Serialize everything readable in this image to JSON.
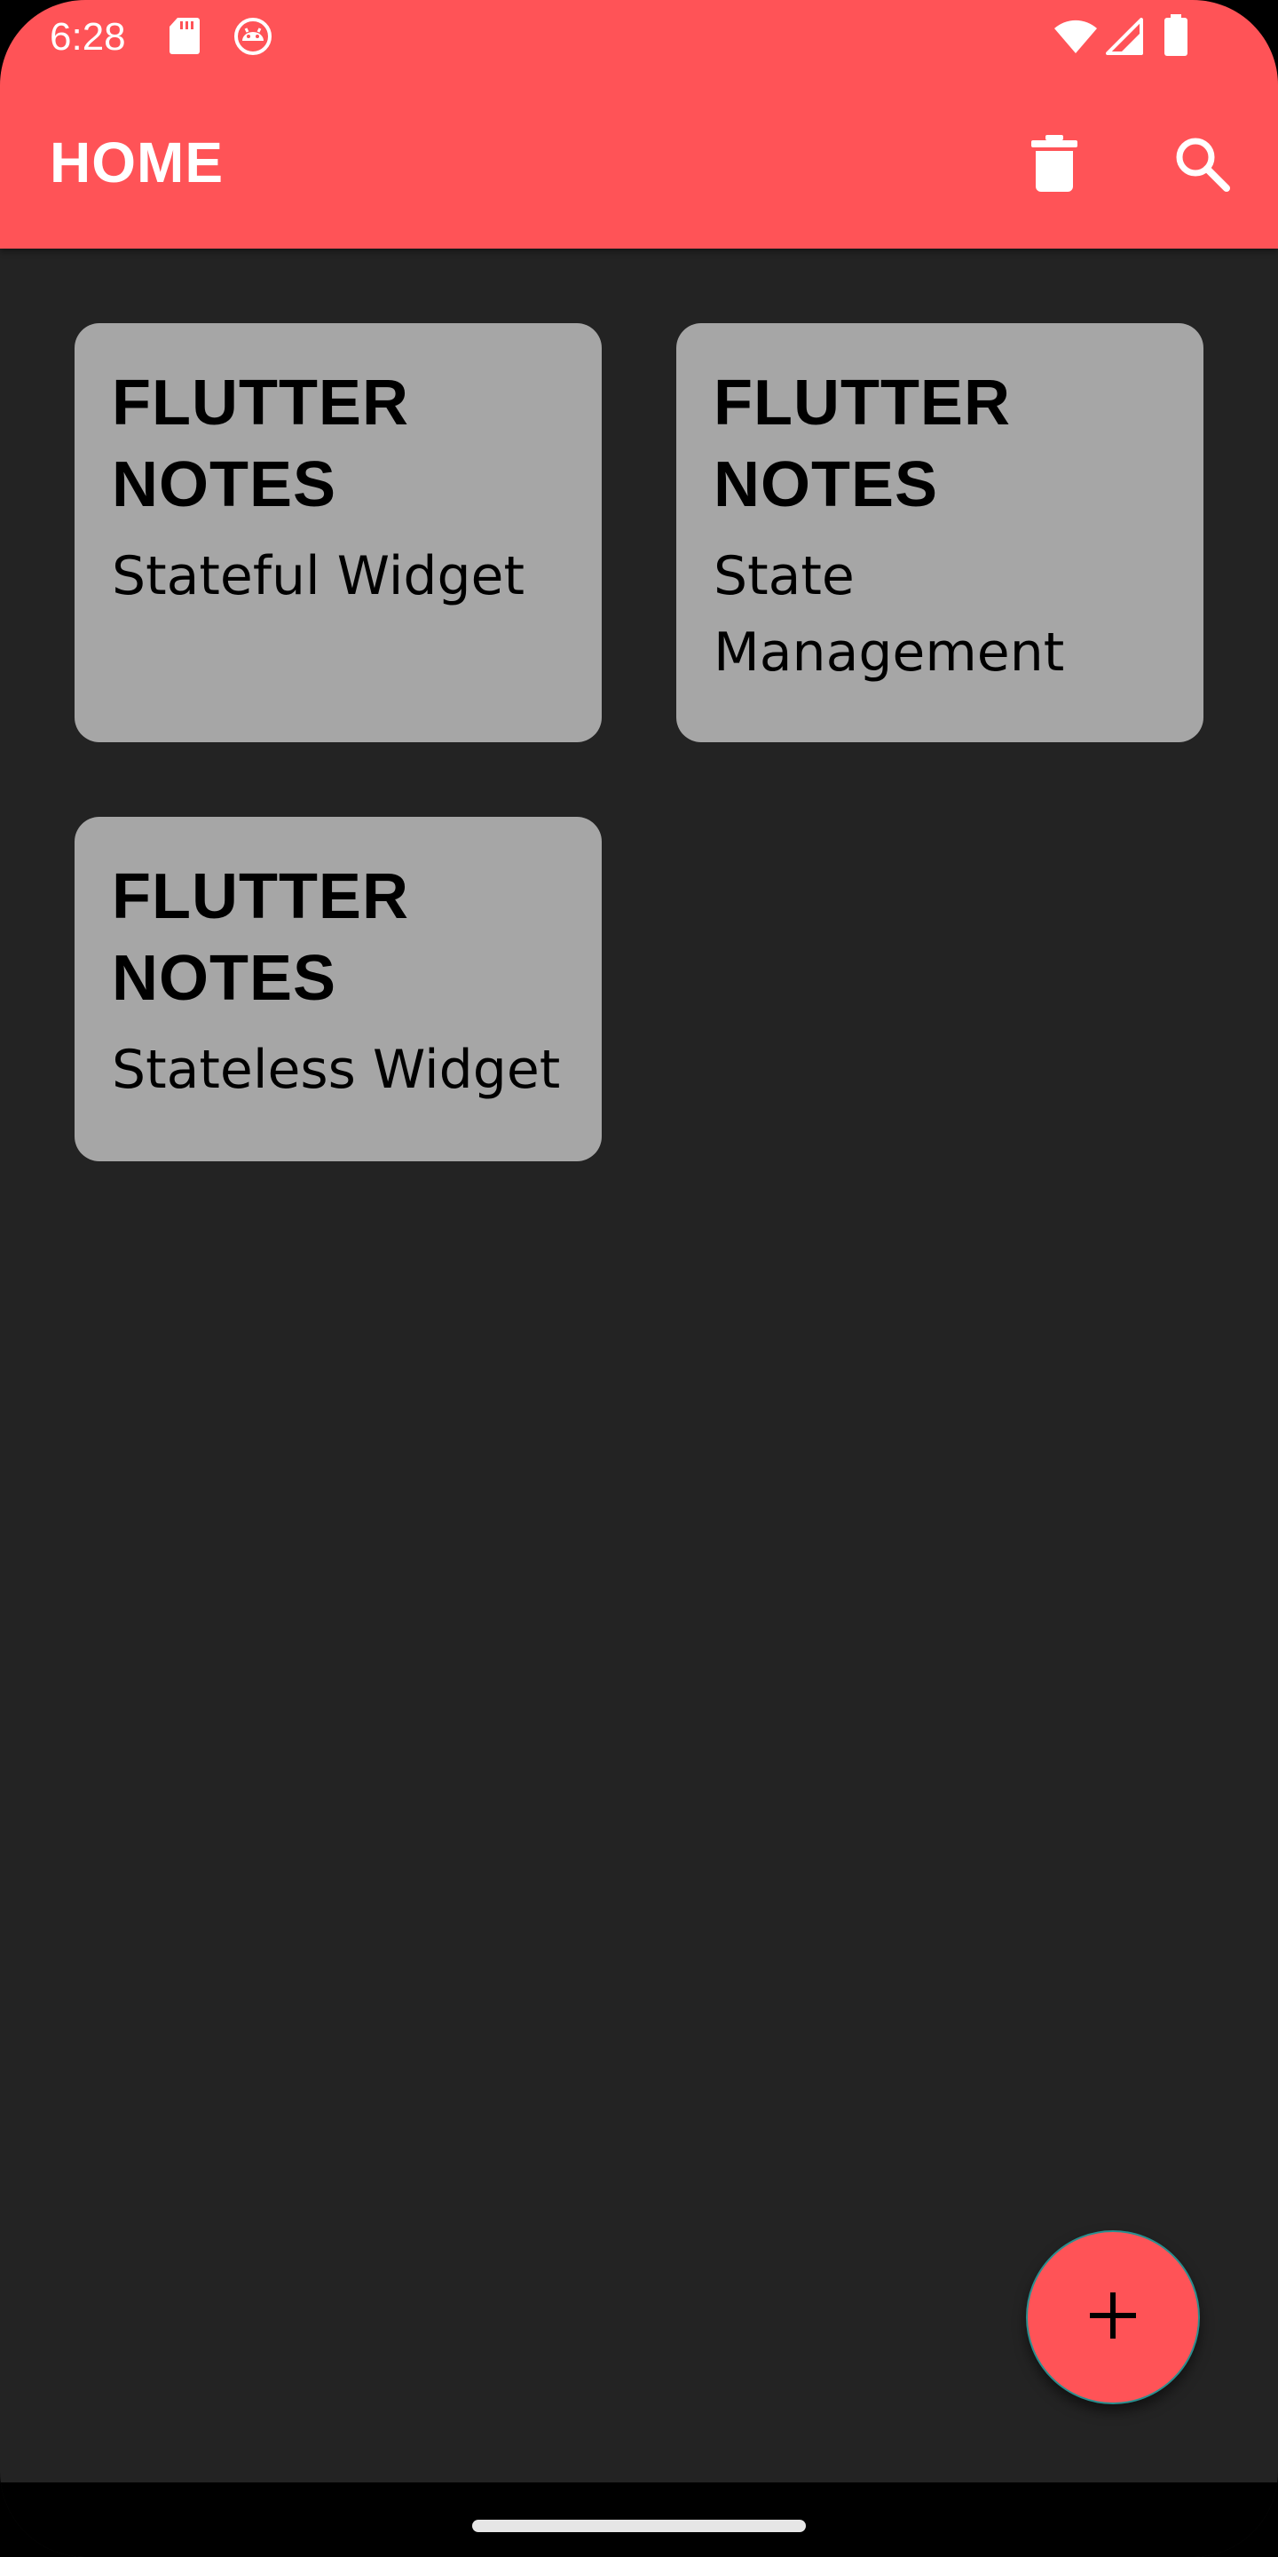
{
  "status_bar": {
    "time": "6:28",
    "icons": [
      "sd-card-icon",
      "android-debug-icon",
      "wifi-icon",
      "signal-icon",
      "battery-icon"
    ]
  },
  "app_bar": {
    "title": "HOME",
    "actions": [
      "delete-icon",
      "search-icon"
    ]
  },
  "notes": [
    {
      "title": "FLUTTER\nNOTES",
      "body": "Stateful Widget"
    },
    {
      "title": "FLUTTER\nNOTES",
      "body": "State\nManagement"
    },
    {
      "title": "FLUTTER\nNOTES",
      "body": "Stateless Widget"
    }
  ],
  "fab": {
    "icon": "add-icon"
  },
  "colors": {
    "accent": "#ff5357",
    "background": "#232323",
    "card": "#a6a6a6"
  }
}
